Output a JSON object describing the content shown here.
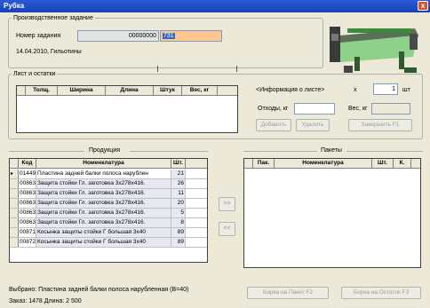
{
  "window": {
    "title": "Рубка",
    "close_label": "x"
  },
  "task": {
    "legend": "Производственное задание",
    "number_label": "Номер задания",
    "number_value": "00000000",
    "number_suffix": "731",
    "date_line": "14.04.2010, Гильотины"
  },
  "sheet": {
    "legend": "Лист и остатки",
    "columns": [
      "Толщ.",
      "Ширина",
      "Длина",
      "Штук",
      "Вес, кг"
    ],
    "info_label": "<Информация о листе>",
    "x_label": "x",
    "qty_value": "1",
    "qty_unit": "шт",
    "waste_label": "Отходы, кг",
    "weight_label": "Вес, кг",
    "add_button": "Добавить",
    "delete_button": "Удалить",
    "finish_button": "Завершить  F1"
  },
  "products": {
    "legend": "Продукция",
    "columns": [
      "Код",
      "Номенклатура",
      "Шт."
    ],
    "rows": [
      {
        "code": "01449",
        "name": "Пластина задней балки полоса нарублен",
        "qty": "21"
      },
      {
        "code": "00863",
        "name": "Защита стойки Гл. заготовка 3х278х416.",
        "qty": "26"
      },
      {
        "code": "00863",
        "name": "Защита стойки Гл. заготовка 3х278х416.",
        "qty": "11"
      },
      {
        "code": "00863",
        "name": "Защита стойки Гл. заготовка 3х278х416.",
        "qty": "20"
      },
      {
        "code": "00863",
        "name": "Защита стойки Гл. заготовка 3х278х416.",
        "qty": "5"
      },
      {
        "code": "00863",
        "name": "Защита стойки Гл. заготовка 3х278х416.",
        "qty": "8"
      },
      {
        "code": "00871",
        "name": "Косынка защиты стойки Г большая 3х40",
        "qty": "89"
      },
      {
        "code": "00872",
        "name": "Косынка защиты стойки Г большая 3х40",
        "qty": "89"
      }
    ],
    "selected_line": "Выбрано: Пластина задней балки полоса нарубленная (В=40)",
    "order_line": "Заказ: 1478  Длина: 2 500"
  },
  "transfer": {
    "right_label": ">>",
    "left_label": "<<"
  },
  "packs": {
    "legend": "Пакеты",
    "columns": [
      "Пак.",
      "Номенклатура",
      "Шт.",
      "К."
    ],
    "tag_pack_button": "Бирка на Пакет  F2",
    "tag_rest_button": "Бирка на Остаток  F3"
  }
}
